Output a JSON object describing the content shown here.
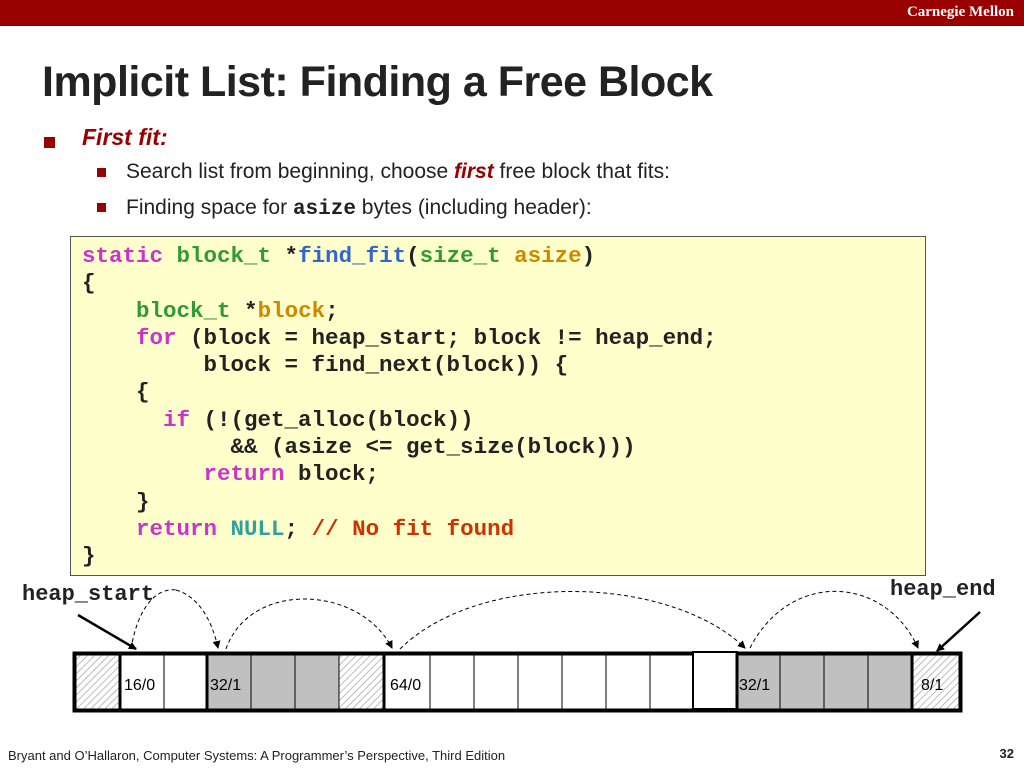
{
  "header": {
    "org": "Carnegie Mellon"
  },
  "slide": {
    "title": "Implicit List: Finding a Free Block",
    "bullet": "First fit:",
    "sub1": {
      "before": "Search list from beginning, choose ",
      "emph": "first",
      "after": " free block that fits:"
    },
    "sub2": {
      "before": "Finding space for ",
      "code": "asize",
      "after": " bytes (including header):"
    }
  },
  "code_lines": [
    [
      [
        "kw",
        "static "
      ],
      [
        "ty",
        "block_t "
      ],
      [
        "",
        "*"
      ],
      [
        "fn",
        "find_fit"
      ],
      [
        "",
        "("
      ],
      [
        "ty",
        "size_t "
      ],
      [
        "id",
        "asize"
      ],
      [
        "",
        ")"
      ]
    ],
    [
      [
        "",
        "{"
      ]
    ],
    [
      [
        "",
        "    "
      ],
      [
        "ty",
        "block_t "
      ],
      [
        "",
        "*"
      ],
      [
        "id",
        "block"
      ],
      [
        "",
        ";"
      ]
    ],
    [
      [
        "",
        "    "
      ],
      [
        "kw",
        "for "
      ],
      [
        "",
        "(block = heap_start; block != heap_end;"
      ]
    ],
    [
      [
        "",
        "         block = find_next(block)) {"
      ]
    ],
    [
      [
        "",
        "    {"
      ]
    ],
    [
      [
        "",
        "      "
      ],
      [
        "kw",
        "if "
      ],
      [
        "",
        "(!(get_alloc(block))"
      ]
    ],
    [
      [
        "",
        "           && (asize <= get_size(block)))"
      ]
    ],
    [
      [
        "",
        "         "
      ],
      [
        "kw",
        "return "
      ],
      [
        "",
        "block;"
      ]
    ],
    [
      [
        "",
        "    }"
      ]
    ],
    [
      [
        "",
        "    "
      ],
      [
        "kw",
        "return "
      ],
      [
        "nl",
        "NULL"
      ],
      [
        "",
        "; "
      ],
      [
        "cm",
        "// No fit found"
      ]
    ],
    [
      [
        "",
        "}"
      ]
    ]
  ],
  "diagram": {
    "heap_start_label": "heap_start",
    "heap_end_label": "heap_end",
    "block_labels": [
      "16/0",
      "32/1",
      "64/0",
      "32/1",
      "8/1"
    ],
    "colors": {
      "allocated": "#c0c0c0",
      "free": "#ffffff",
      "border": "#000000"
    }
  },
  "footer": {
    "citation": "Bryant and O’Hallaron, Computer Systems: A Programmer’s Perspective, Third Edition",
    "page": "32"
  }
}
